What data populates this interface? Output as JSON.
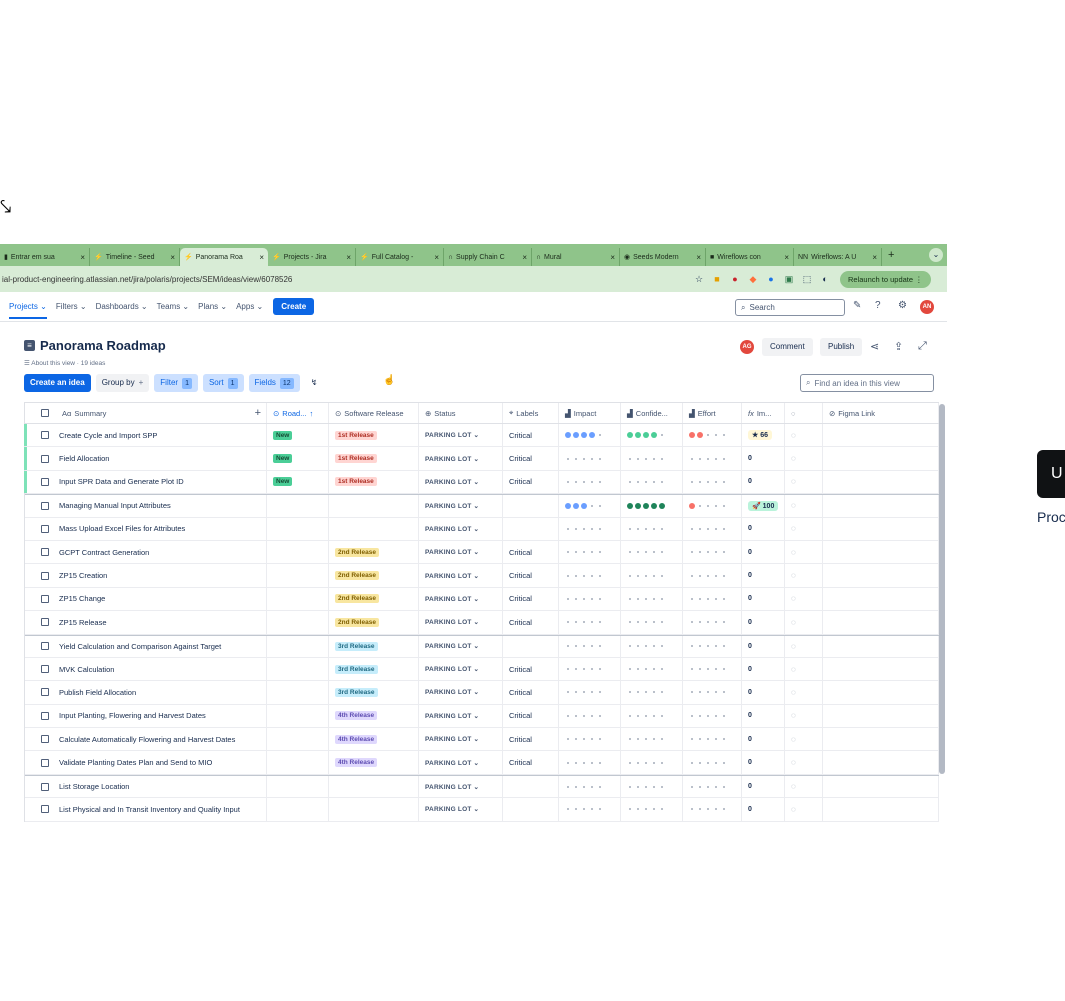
{
  "browser": {
    "tabs": [
      {
        "label": "Entrar em sua",
        "icon": "▮",
        "active": false
      },
      {
        "label": "Timeline - Seed",
        "icon": "⚡",
        "active": false
      },
      {
        "label": "Panorama Roa",
        "icon": "⚡",
        "active": true
      },
      {
        "label": "Projects - Jira",
        "icon": "⚡",
        "active": false
      },
      {
        "label": "Full Catalog -",
        "icon": "⚡",
        "active": false
      },
      {
        "label": "Supply Chain C",
        "icon": "∩",
        "active": false
      },
      {
        "label": "Mural",
        "icon": "∩",
        "active": false
      },
      {
        "label": "Seeds Modern",
        "icon": "◉",
        "active": false
      },
      {
        "label": "Wireflows con",
        "icon": "■",
        "active": false
      },
      {
        "label": "Wireflows: A U",
        "icon": "NN",
        "active": false
      }
    ],
    "url": "ial-product-engineering.atlassian.net/jira/polaris/projects/SEM/ideas/view/6078526",
    "relaunch_label": "Relaunch to update"
  },
  "nav": {
    "items": [
      "Projects",
      "Filters",
      "Dashboards",
      "Teams",
      "Plans",
      "Apps"
    ],
    "create_label": "Create",
    "search_placeholder": "Search",
    "avatar_initials": "AN"
  },
  "page": {
    "title": "Panorama Roadmap",
    "about": "About this view · 19 ideas",
    "avatar_initials": "AG",
    "comment_label": "Comment",
    "publish_label": "Publish"
  },
  "toolbar": {
    "create_idea": "Create an idea",
    "group_by": "Group by",
    "filter": "Filter",
    "filter_count": "1",
    "sort": "Sort",
    "sort_count": "1",
    "fields": "Fields",
    "fields_count": "12",
    "find_placeholder": "Find an idea in this view"
  },
  "table": {
    "columns": [
      "Summary",
      "Road...",
      "Software Release",
      "Status",
      "Labels",
      "Impact",
      "Confide...",
      "Effort",
      "Im...",
      "",
      "Figma Link"
    ],
    "rows": [
      {
        "summary": "Create Cycle and Import SPP",
        "road": "New",
        "release": "1st Release",
        "rel": 1,
        "status": "PARKING LOT",
        "label": "Critical",
        "impact": [
          4,
          "b"
        ],
        "conf": [
          4,
          "g"
        ],
        "effort": [
          2,
          "r"
        ],
        "score": "66",
        "badge": "star",
        "green": true
      },
      {
        "summary": "Field Allocation",
        "road": "New",
        "release": "1st Release",
        "rel": 1,
        "status": "PARKING LOT",
        "label": "Critical",
        "impact": [
          0,
          ""
        ],
        "conf": [
          0,
          ""
        ],
        "effort": [
          0,
          ""
        ],
        "score": "0",
        "badge": "",
        "green": true
      },
      {
        "summary": "Input SPR Data and Generate Plot ID",
        "road": "New",
        "release": "1st Release",
        "rel": 1,
        "status": "PARKING LOT",
        "label": "Critical",
        "impact": [
          0,
          ""
        ],
        "conf": [
          0,
          ""
        ],
        "effort": [
          0,
          ""
        ],
        "score": "0",
        "badge": "",
        "green": true
      },
      {
        "summary": "Managing Manual Input Attributes",
        "road": "",
        "release": "",
        "rel": 0,
        "status": "PARKING LOT",
        "label": "",
        "impact": [
          3,
          "b"
        ],
        "conf": [
          5,
          "dg"
        ],
        "effort": [
          1,
          "r"
        ],
        "score": "100",
        "badge": "rocket",
        "green": false,
        "group": true
      },
      {
        "summary": "Mass Upload Excel Files for Attributes",
        "road": "",
        "release": "",
        "rel": 0,
        "status": "PARKING LOT",
        "label": "",
        "impact": [
          0,
          ""
        ],
        "conf": [
          0,
          ""
        ],
        "effort": [
          0,
          ""
        ],
        "score": "0",
        "badge": "",
        "green": false
      },
      {
        "summary": "GCPT Contract Generation",
        "road": "",
        "release": "2nd Release",
        "rel": 2,
        "status": "PARKING LOT",
        "label": "Critical",
        "impact": [
          0,
          ""
        ],
        "conf": [
          0,
          ""
        ],
        "effort": [
          0,
          ""
        ],
        "score": "0",
        "badge": "",
        "green": false
      },
      {
        "summary": "ZP15 Creation",
        "road": "",
        "release": "2nd Release",
        "rel": 2,
        "status": "PARKING LOT",
        "label": "Critical",
        "impact": [
          0,
          ""
        ],
        "conf": [
          0,
          ""
        ],
        "effort": [
          0,
          ""
        ],
        "score": "0",
        "badge": "",
        "green": false
      },
      {
        "summary": "ZP15 Change",
        "road": "",
        "release": "2nd Release",
        "rel": 2,
        "status": "PARKING LOT",
        "label": "Critical",
        "impact": [
          0,
          ""
        ],
        "conf": [
          0,
          ""
        ],
        "effort": [
          0,
          ""
        ],
        "score": "0",
        "badge": "",
        "green": false
      },
      {
        "summary": "ZP15 Release",
        "road": "",
        "release": "2nd Release",
        "rel": 2,
        "status": "PARKING LOT",
        "label": "Critical",
        "impact": [
          0,
          ""
        ],
        "conf": [
          0,
          ""
        ],
        "effort": [
          0,
          ""
        ],
        "score": "0",
        "badge": "",
        "green": false
      },
      {
        "summary": "Yield Calculation and Comparison Against Target",
        "road": "",
        "release": "3rd Release",
        "rel": 3,
        "status": "PARKING LOT",
        "label": "",
        "impact": [
          0,
          ""
        ],
        "conf": [
          0,
          ""
        ],
        "effort": [
          0,
          ""
        ],
        "score": "0",
        "badge": "",
        "green": false,
        "group": true
      },
      {
        "summary": "MVK Calculation",
        "road": "",
        "release": "3rd Release",
        "rel": 3,
        "status": "PARKING LOT",
        "label": "Critical",
        "impact": [
          0,
          ""
        ],
        "conf": [
          0,
          ""
        ],
        "effort": [
          0,
          ""
        ],
        "score": "0",
        "badge": "",
        "green": false
      },
      {
        "summary": "Publish Field Allocation",
        "road": "",
        "release": "3rd Release",
        "rel": 3,
        "status": "PARKING LOT",
        "label": "Critical",
        "impact": [
          0,
          ""
        ],
        "conf": [
          0,
          ""
        ],
        "effort": [
          0,
          ""
        ],
        "score": "0",
        "badge": "",
        "green": false
      },
      {
        "summary": "Input Planting, Flowering and Harvest Dates",
        "road": "",
        "release": "4th Release",
        "rel": 4,
        "status": "PARKING LOT",
        "label": "Critical",
        "impact": [
          0,
          ""
        ],
        "conf": [
          0,
          ""
        ],
        "effort": [
          0,
          ""
        ],
        "score": "0",
        "badge": "",
        "green": false
      },
      {
        "summary": "Calculate Automatically Flowering and Harvest Dates",
        "road": "",
        "release": "4th Release",
        "rel": 4,
        "status": "PARKING LOT",
        "label": "Critical",
        "impact": [
          0,
          ""
        ],
        "conf": [
          0,
          ""
        ],
        "effort": [
          0,
          ""
        ],
        "score": "0",
        "badge": "",
        "green": false
      },
      {
        "summary": "Validate Planting Dates Plan and Send to MIO",
        "road": "",
        "release": "4th Release",
        "rel": 4,
        "status": "PARKING LOT",
        "label": "Critical",
        "impact": [
          0,
          ""
        ],
        "conf": [
          0,
          ""
        ],
        "effort": [
          0,
          ""
        ],
        "score": "0",
        "badge": "",
        "green": false
      },
      {
        "summary": "List Storage Location",
        "road": "",
        "release": "",
        "rel": 0,
        "status": "PARKING LOT",
        "label": "",
        "impact": [
          0,
          ""
        ],
        "conf": [
          0,
          ""
        ],
        "effort": [
          0,
          ""
        ],
        "score": "0",
        "badge": "",
        "green": false,
        "group": true
      },
      {
        "summary": "List Physical and In Transit Inventory and Quality Input",
        "road": "",
        "release": "",
        "rel": 0,
        "status": "PARKING LOT",
        "label": "",
        "impact": [
          0,
          ""
        ],
        "conf": [
          0,
          ""
        ],
        "effort": [
          0,
          ""
        ],
        "score": "0",
        "badge": "",
        "green": false
      }
    ]
  },
  "side_panel": {
    "button_label": "U",
    "text": "Proc proc"
  },
  "colors": {
    "accent": "#0c66e4",
    "tabbar": "#8fc48a",
    "new": "#4bce97"
  }
}
